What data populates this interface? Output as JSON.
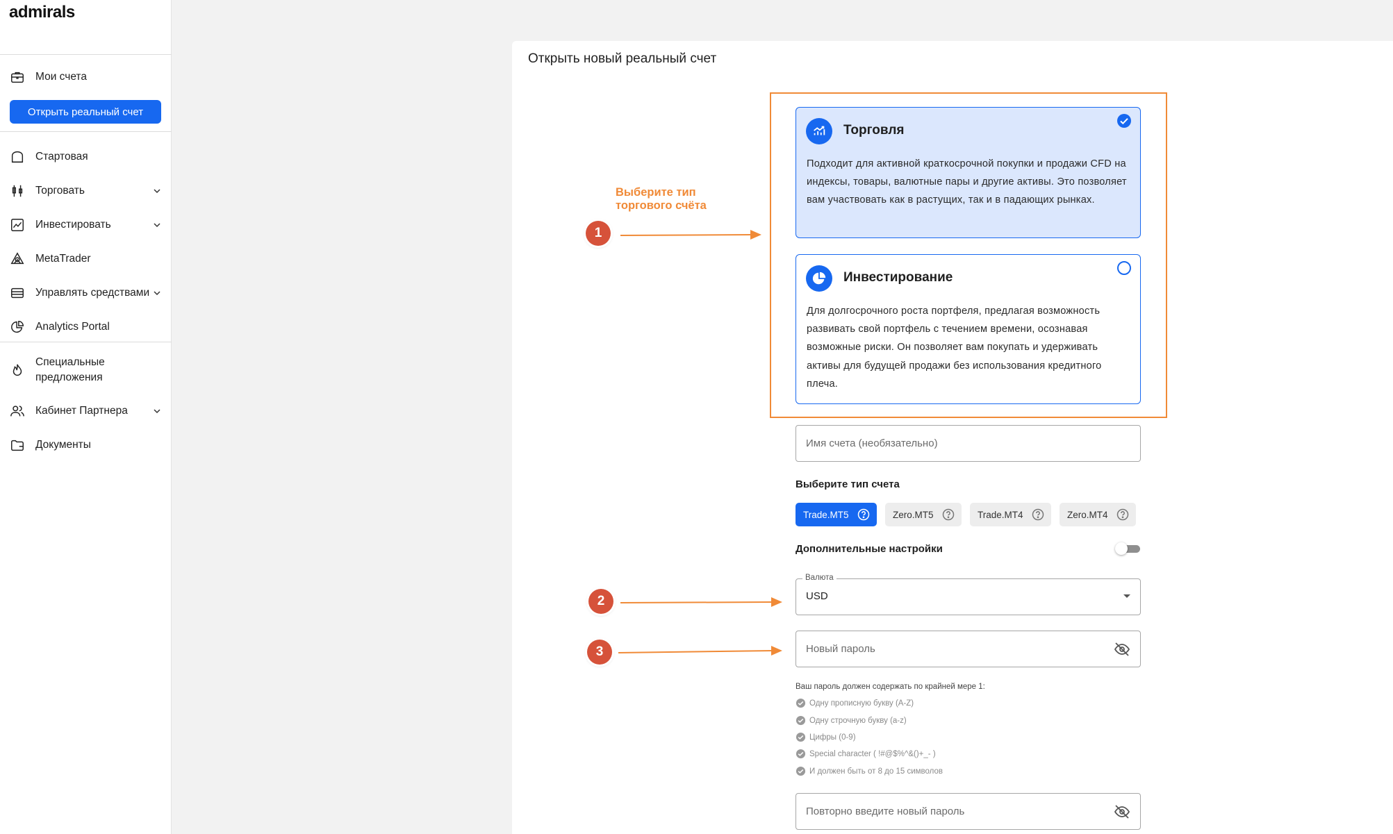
{
  "brand": {
    "logo": "admirals"
  },
  "sidebar": {
    "my_accounts": "Мои счета",
    "open_real_account": "Открыть реальный счет",
    "items": [
      {
        "label": "Стартовая"
      },
      {
        "label": "Торговать"
      },
      {
        "label": "Инвестировать"
      },
      {
        "label": "MetaTrader"
      },
      {
        "label": "Управлять средствами"
      },
      {
        "label": "Analytics Portal"
      },
      {
        "label": "Специальные предложения"
      },
      {
        "label": "Кабинет Партнера"
      },
      {
        "label": "Документы"
      }
    ]
  },
  "main": {
    "title": "Открыть новый реальный счет",
    "cards": [
      {
        "title": "Торговля",
        "description": "Подходит для активной краткосрочной покупки и продажи CFD на индексы, товары, валютные пары и другие активы. Это позволяет вам участвовать как в растущих, так и в падающих рынках.",
        "selected": true
      },
      {
        "title": "Инвестирование",
        "description": "Для долгосрочного роста портфеля, предлагая возможность развивать свой портфель с течением времени, осознавая возможные риски. Он позволяет вам покупать и удерживать активы для будущей продажи без использования кредитного плеча.",
        "selected": false
      }
    ],
    "account_name_placeholder": "Имя счета (необязательно)",
    "account_type_label": "Выберите тип счета",
    "account_types": [
      {
        "label": "Trade.MT5",
        "active": true
      },
      {
        "label": "Zero.MT5",
        "active": false
      },
      {
        "label": "Trade.MT4",
        "active": false
      },
      {
        "label": "Zero.MT4",
        "active": false
      }
    ],
    "advanced_settings_label": "Дополнительные настройки",
    "currency": {
      "label": "Валюта",
      "value": "USD"
    },
    "new_password_placeholder": "Новый пароль",
    "password_requirements": {
      "title": "Ваш пароль должен содержать по крайней мере 1:",
      "items": [
        "Одну прописную букву (A-Z)",
        "Одну строчную букву (a-z)",
        "Цифры (0-9)",
        "Special character ( !#@$%^&()+_- )",
        "И должен быть от 8 до 15 символов"
      ]
    },
    "repeat_password_placeholder": "Повторно введите новый пароль"
  },
  "annotations": {
    "hint_line1": "Выберите тип",
    "hint_line2": "торгового счёта",
    "badges": [
      "1",
      "2",
      "3"
    ]
  },
  "colors": {
    "primary": "#1768f0",
    "selected_card_bg": "#dbe7fd",
    "annotation_orange": "#f08a37",
    "badge_red": "#d6523a"
  }
}
